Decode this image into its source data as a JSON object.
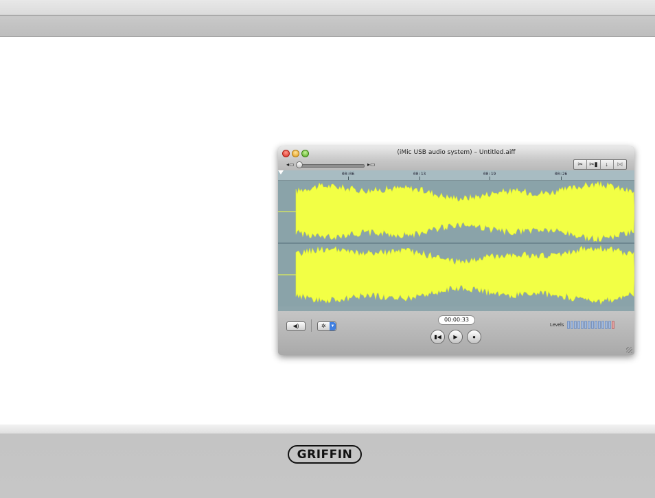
{
  "window": {
    "title": "(iMic USB audio system) – Untitled.aiff"
  },
  "ruler": {
    "ticks": [
      "00:06",
      "00:13",
      "00:19",
      "00:26"
    ]
  },
  "transport": {
    "time": "00:00:33",
    "levels_label": "Levels"
  },
  "icons": {
    "volume_low": "volume-low-icon",
    "volume_high": "volume-high-icon",
    "cut": "scissors-icon",
    "trim": "trim-icon",
    "insert": "insert-icon",
    "disabled_tool": "merge-icon",
    "speaker": "speaker-icon",
    "gear": "gear-icon",
    "rewind": "rewind-icon",
    "play": "play-icon",
    "record": "record-icon"
  },
  "colors": {
    "waveform": "#f2ff45",
    "track_background": "#8aa3a9"
  },
  "brand": {
    "logo_text": "GRIFFIN"
  }
}
